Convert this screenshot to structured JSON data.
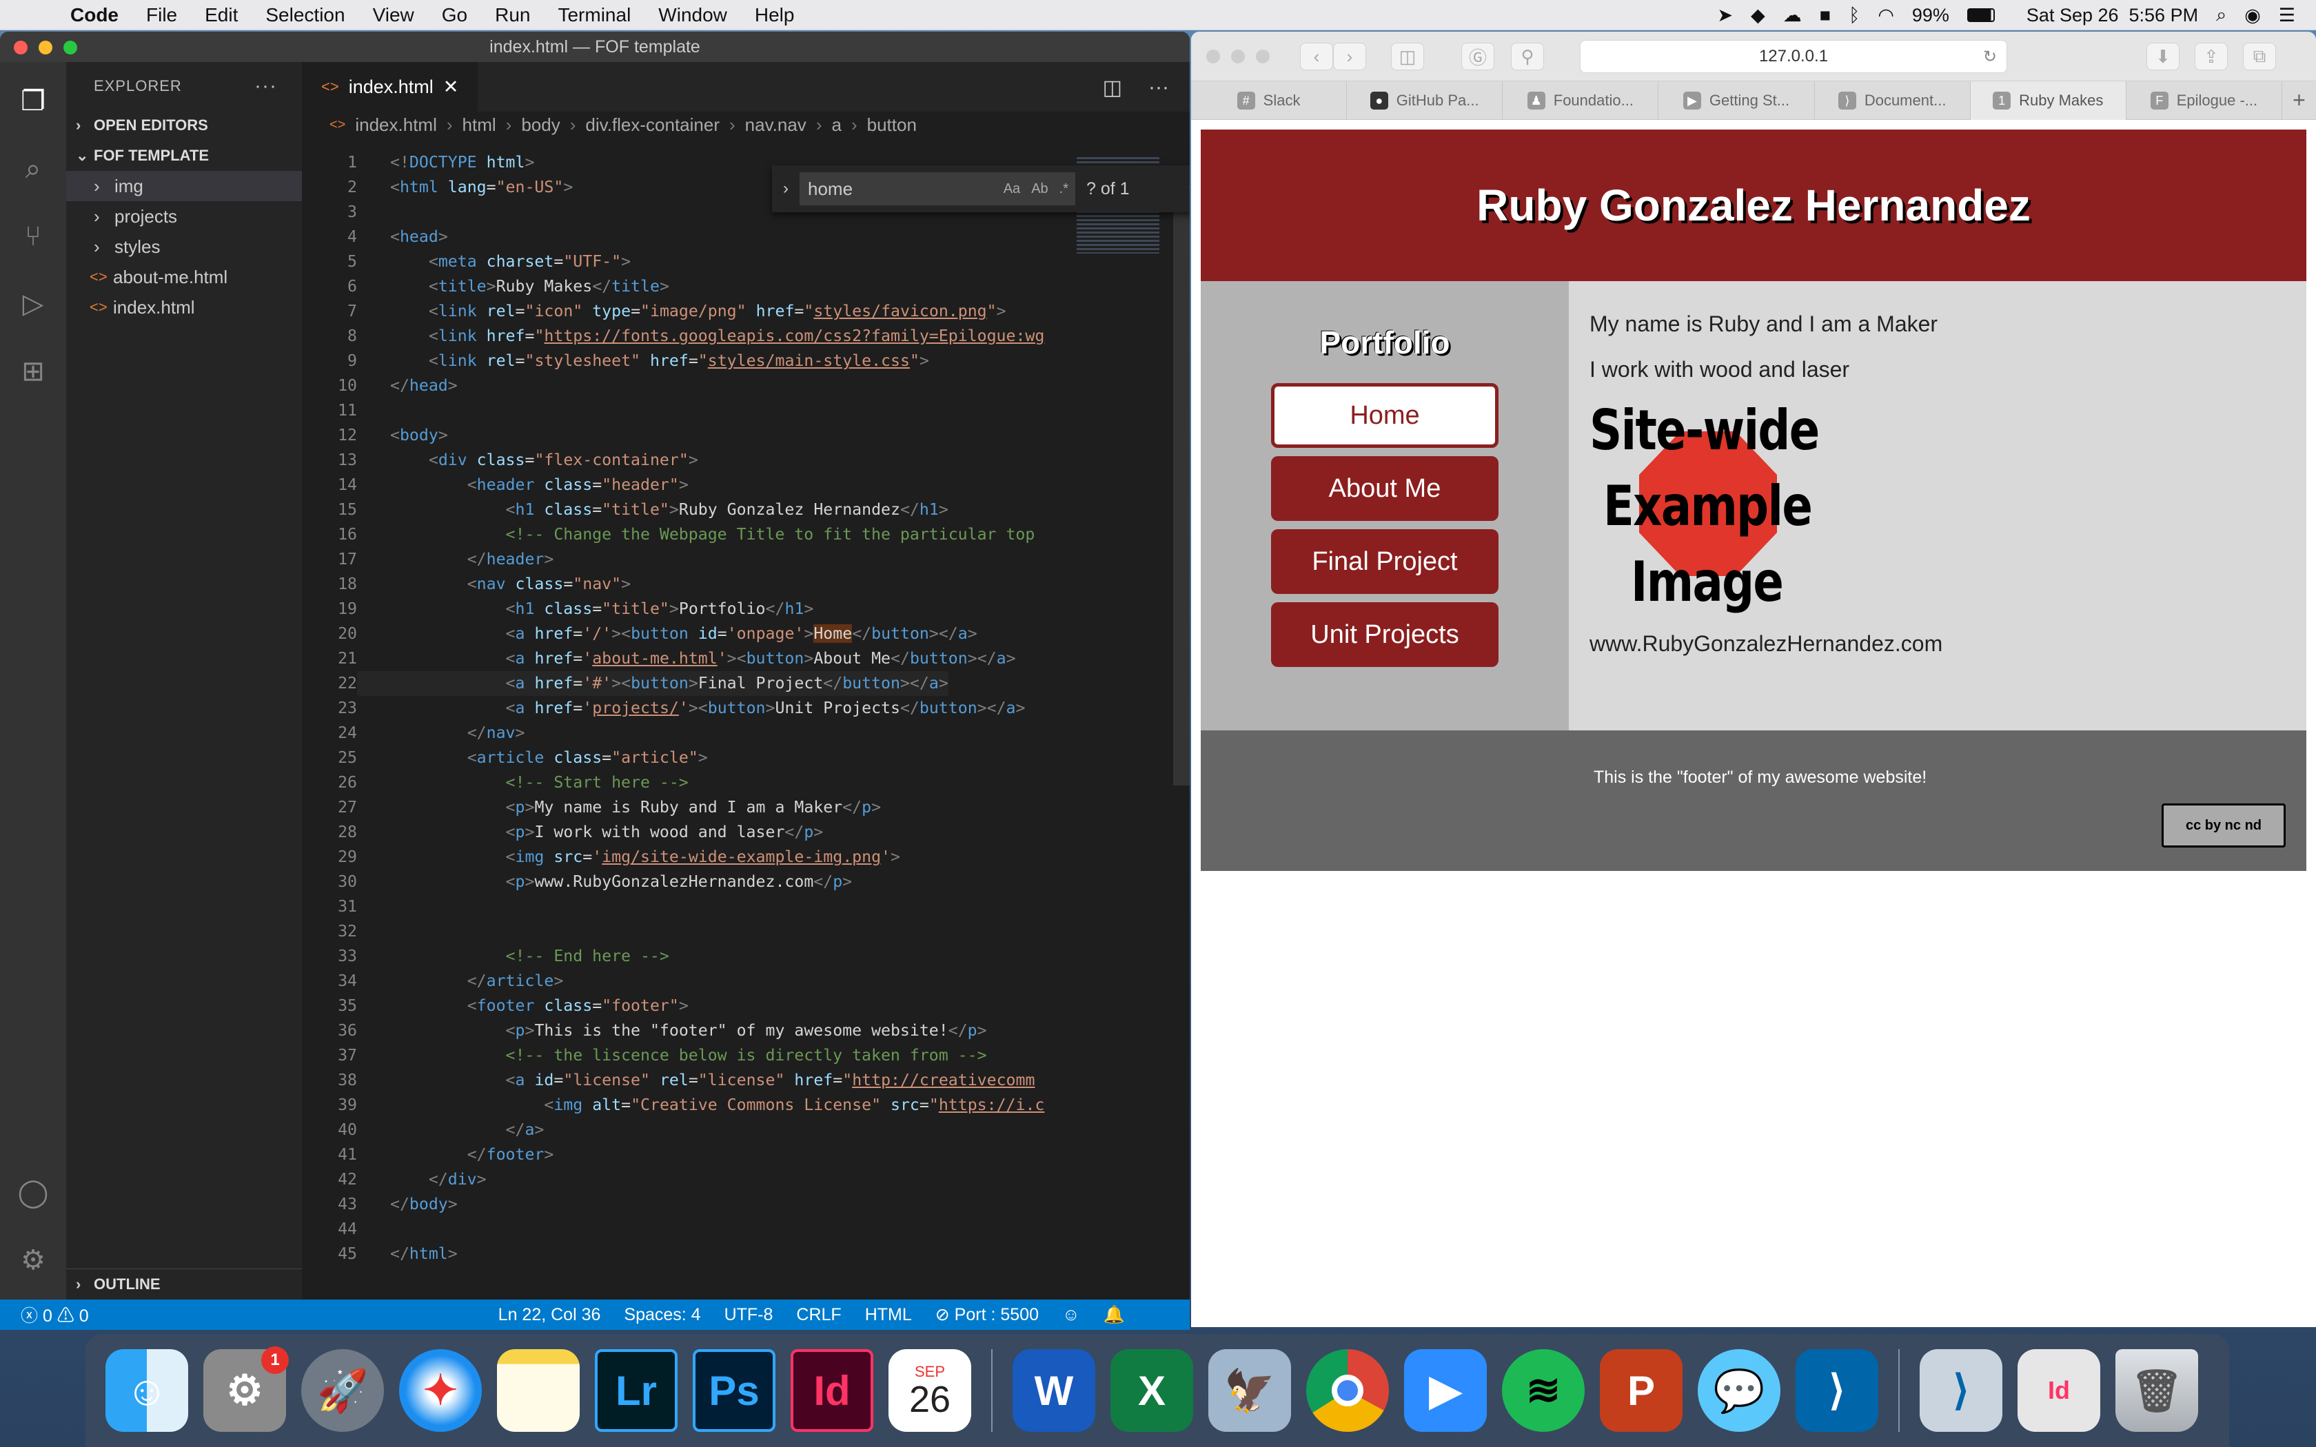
{
  "menubar": {
    "app_name": "Code",
    "menus": [
      "File",
      "Edit",
      "Selection",
      "View",
      "Go",
      "Run",
      "Terminal",
      "Window",
      "Help"
    ],
    "battery": "99%",
    "datetime": "Sat Sep 26  5:56 PM"
  },
  "vscode": {
    "window_title": "index.html — FOF template",
    "explorer_title": "EXPLORER",
    "open_editors": "OPEN EDITORS",
    "folder": "FOF TEMPLATE",
    "tree": [
      {
        "label": "img",
        "type": "folder"
      },
      {
        "label": "projects",
        "type": "folder"
      },
      {
        "label": "styles",
        "type": "folder"
      },
      {
        "label": "about-me.html",
        "type": "file"
      },
      {
        "label": "index.html",
        "type": "file"
      }
    ],
    "outline": "OUTLINE",
    "tab_label": "index.html",
    "breadcrumb": [
      "index.html",
      "html",
      "body",
      "div.flex-container",
      "nav.nav",
      "a",
      "button"
    ],
    "find": {
      "query": "home",
      "count": "? of 1"
    },
    "status": {
      "problems": "0",
      "warnings": "0",
      "position": "Ln 22, Col 36",
      "spaces": "Spaces: 4",
      "encoding": "UTF-8",
      "eol": "CRLF",
      "language": "HTML",
      "port": "Port : 5500"
    }
  },
  "safari": {
    "url": "127.0.0.1",
    "tabs": [
      "Slack",
      "GitHub Pa...",
      "Foundatio...",
      "Getting St...",
      "Document...",
      "Ruby Makes",
      "Epilogue -..."
    ],
    "active_tab": "Ruby Makes"
  },
  "site": {
    "title": "Ruby Gonzalez Hernandez",
    "nav_title": "Portfolio",
    "nav": [
      "Home",
      "About Me",
      "Final Project",
      "Unit Projects"
    ],
    "p1": "My name is Ruby and I am a Maker",
    "p2": "I work with wood and laser",
    "image_lines": [
      "Site-wide",
      "Example",
      "Image"
    ],
    "url_text": "www.RubyGonzalezHernandez.com",
    "footer": "This is the \"footer\" of my awesome website!",
    "license_badge": "cc by nc nd"
  },
  "dock": {
    "calendar_month": "SEP",
    "calendar_day": "26",
    "prefs_badge": "1",
    "icons": [
      "finder-icon",
      "system-preferences-icon",
      "launchpad-icon",
      "safari-icon",
      "notes-icon",
      "lightroom-icon",
      "photoshop-icon",
      "indesign-icon",
      "calendar-icon",
      "word-icon",
      "excel-icon",
      "preview-icon",
      "chrome-icon",
      "zoom-icon",
      "spotify-icon",
      "powerpoint-icon",
      "messages-icon",
      "vscode-icon",
      "vscode-doc-icon",
      "indesign-doc-icon",
      "trash-icon"
    ]
  },
  "colors": {
    "site_red": "#8b1f1f",
    "vscode_blue": "#007acc",
    "nav_gray": "#b3b3b3",
    "article_gray": "#d9d9d9",
    "footer_gray": "#666666"
  }
}
